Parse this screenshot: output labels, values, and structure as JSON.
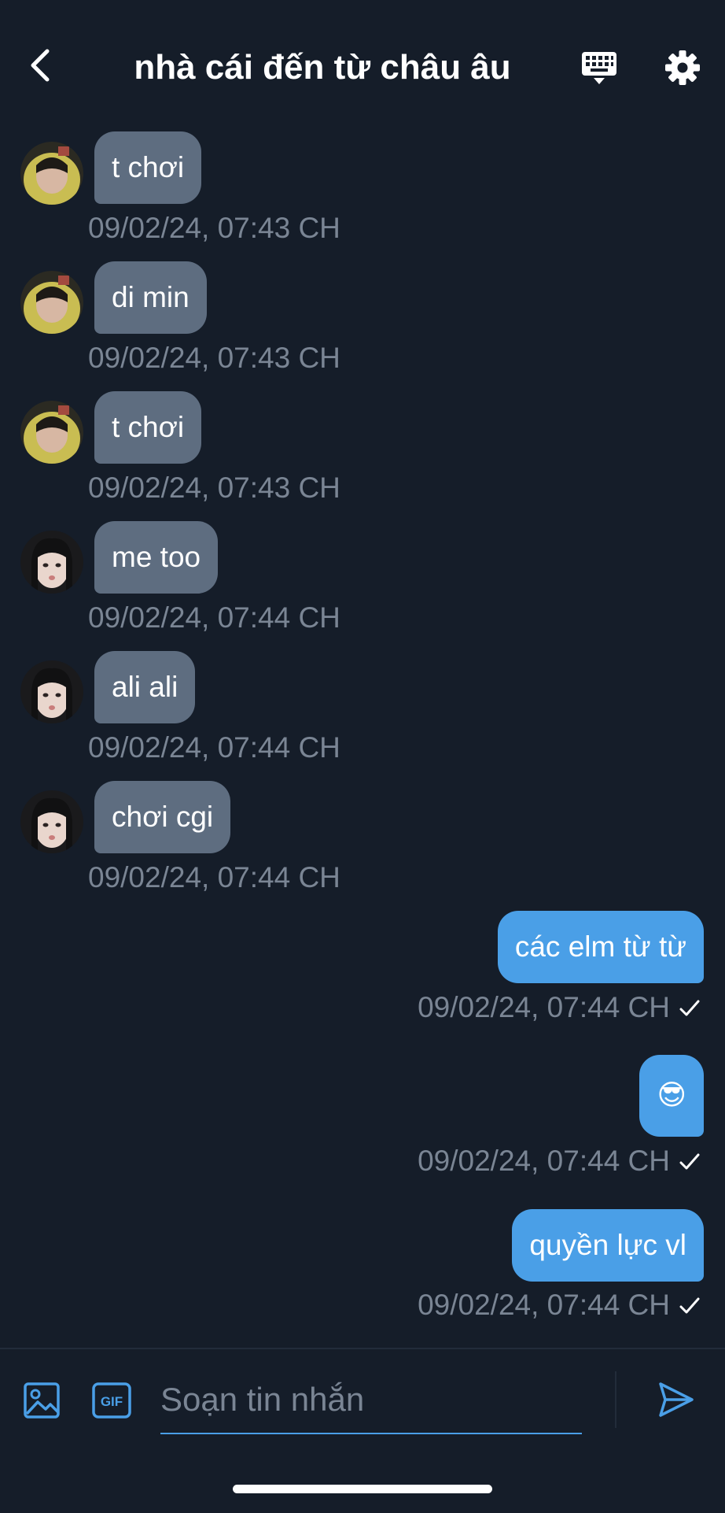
{
  "header": {
    "title": "nhà cái đến từ châu âu",
    "back_icon": "chevron-left-icon",
    "keyboard_icon": "keyboard-icon",
    "settings_icon": "gear-icon"
  },
  "messages": [
    {
      "direction": "in",
      "text": "t chơi",
      "timestamp": "09/02/24, 07:43 CH",
      "avatar": "user-yellow-hoodie"
    },
    {
      "direction": "in",
      "text": "di min",
      "timestamp": "09/02/24, 07:43 CH",
      "avatar": "user-yellow-hoodie"
    },
    {
      "direction": "in",
      "text": "t chơi",
      "timestamp": "09/02/24, 07:43 CH",
      "avatar": "user-yellow-hoodie"
    },
    {
      "direction": "in",
      "text": "me too",
      "timestamp": "09/02/24, 07:44 CH",
      "avatar": "user-selfie"
    },
    {
      "direction": "in",
      "text": "ali ali",
      "timestamp": "09/02/24, 07:44 CH",
      "avatar": "user-selfie"
    },
    {
      "direction": "in",
      "text": "chơi cgi",
      "timestamp": "09/02/24, 07:44 CH",
      "avatar": "user-selfie"
    },
    {
      "direction": "out",
      "text": "các elm từ từ",
      "timestamp": "09/02/24, 07:44 CH",
      "status": "sent-check-icon"
    },
    {
      "direction": "out",
      "text": "😎",
      "timestamp": "09/02/24, 07:44 CH",
      "status": "sent-check-icon"
    },
    {
      "direction": "out",
      "text": "quyền lực vl",
      "timestamp": "09/02/24, 07:44 CH",
      "status": "sent-check-icon"
    }
  ],
  "composer": {
    "placeholder": "Soạn tin nhắn",
    "value": "",
    "image_icon": "image-icon",
    "gif_label": "GIF",
    "send_icon": "send-icon"
  },
  "colors": {
    "background": "#151d29",
    "incoming_bubble": "#5e6d80",
    "outgoing_bubble": "#4a9fe7",
    "timestamp": "#7a8594",
    "accent": "#4a9fe7"
  }
}
